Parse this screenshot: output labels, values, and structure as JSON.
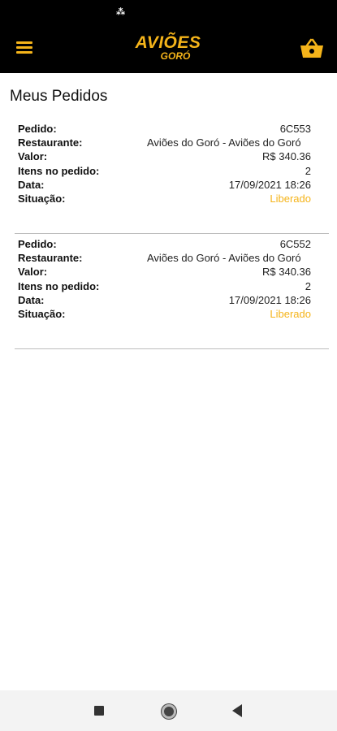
{
  "status_bar": {
    "indicator": "⁂"
  },
  "header": {
    "logo_main": "AVIÕES",
    "logo_sub": "GORÓ",
    "brand_color": "#f5b41a",
    "menu_icon": "hamburger-menu-icon",
    "cart_icon": "basket-icon"
  },
  "page": {
    "title": "Meus Pedidos"
  },
  "labels": {
    "pedido": "Pedido:",
    "restaurante": "Restaurante:",
    "valor": "Valor:",
    "itens": "Itens no pedido:",
    "data": "Data:",
    "situacao": "Situação:"
  },
  "orders": [
    {
      "pedido": "6C553",
      "restaurante": "Aviões do Goró - Aviões do Goró",
      "valor": "R$ 340.36",
      "itens": "2",
      "data": "17/09/2021 18:26",
      "situacao": "Liberado"
    },
    {
      "pedido": "6C552",
      "restaurante": "Aviões do Goró - Aviões do Goró",
      "valor": "R$ 340.36",
      "itens": "2",
      "data": "17/09/2021 18:26",
      "situacao": "Liberado"
    }
  ],
  "colors": {
    "status_liberado": "#f5b41a",
    "app_bar": "#000000"
  }
}
